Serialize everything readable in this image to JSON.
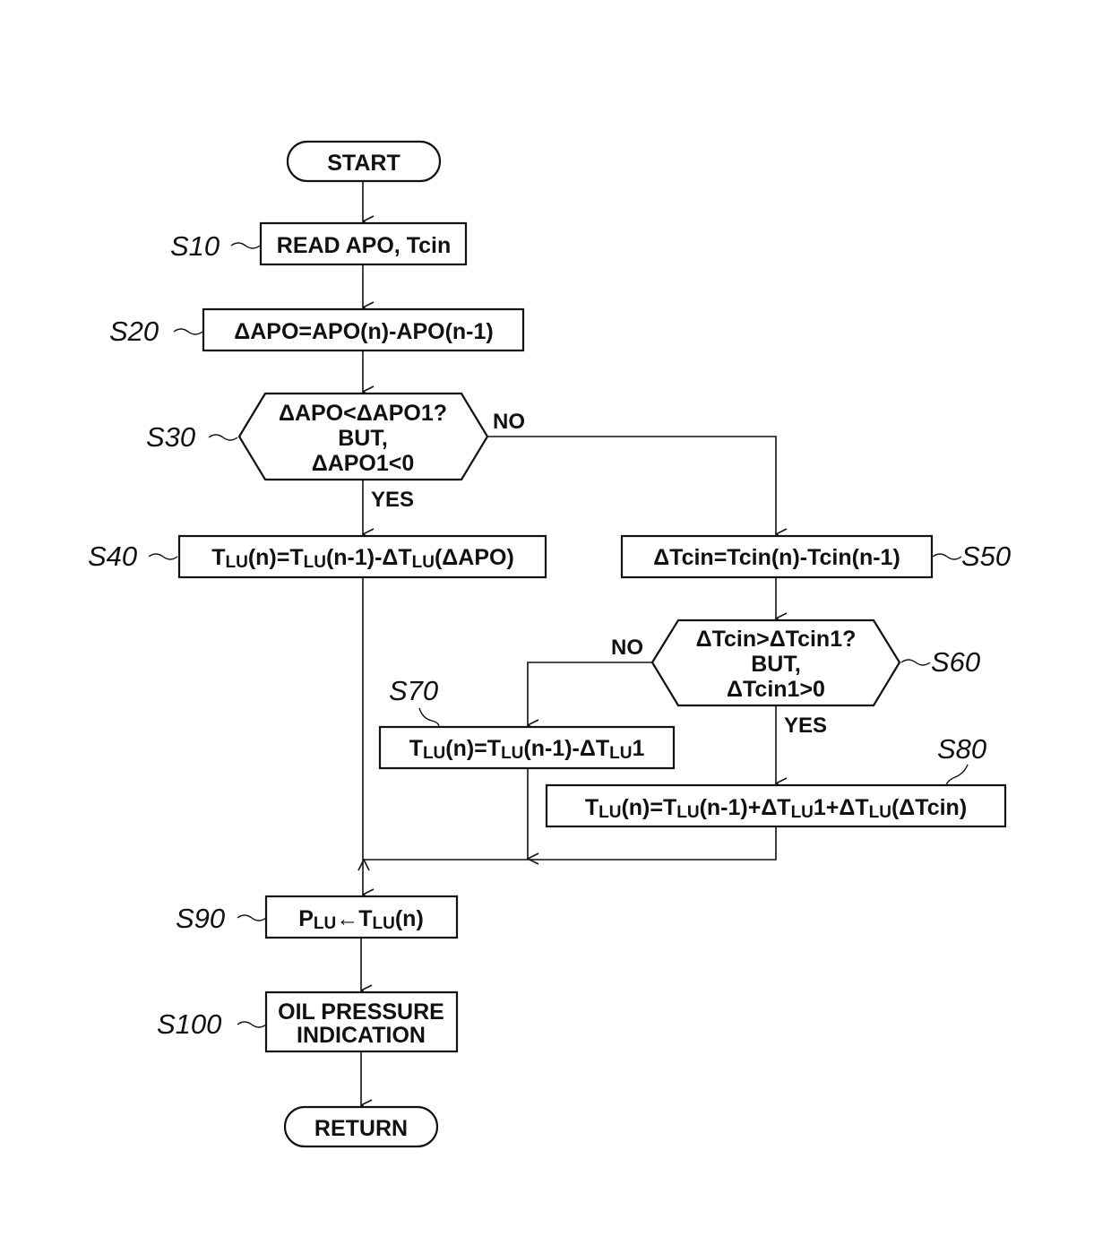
{
  "diagram": {
    "type": "flowchart",
    "terminals": {
      "start": "START",
      "return": "RETURN"
    },
    "steps": {
      "s10": {
        "label": "S10",
        "text": "READ APO, Tcin"
      },
      "s20": {
        "label": "S20",
        "text": "ΔAPO=APO(n)-APO(n-1)"
      },
      "s30": {
        "label": "S30",
        "line1": "ΔAPO<ΔAPO1?",
        "line2": "BUT,",
        "line3": "ΔAPO1<0",
        "yes": "YES",
        "no": "NO"
      },
      "s40": {
        "label": "S40",
        "parts": [
          "T",
          "LU",
          "(n)=T",
          "LU",
          "(n-1)-ΔT",
          "LU",
          "(ΔAPO)"
        ]
      },
      "s50": {
        "label": "S50",
        "text": "ΔTcin=Tcin(n)-Tcin(n-1)"
      },
      "s60": {
        "label": "S60",
        "line1": "ΔTcin>ΔTcin1?",
        "line2": "BUT,",
        "line3": "ΔTcin1>0",
        "yes": "YES",
        "no": "NO"
      },
      "s70": {
        "label": "S70",
        "parts": [
          "T",
          "LU",
          "(n)=T",
          "LU",
          "(n-1)-ΔT",
          "LU",
          "1"
        ]
      },
      "s80": {
        "label": "S80",
        "parts": [
          "T",
          "LU",
          "(n)=T",
          "LU",
          "(n-1)+ΔT",
          "LU",
          "1+ΔT",
          "LU",
          "(ΔTcin)"
        ]
      },
      "s90": {
        "label": "S90",
        "parts": [
          "P",
          "LU",
          "←T",
          "LU",
          "(n)"
        ]
      },
      "s100": {
        "label": "S100",
        "line1": "OIL PRESSURE",
        "line2": "INDICATION"
      }
    }
  }
}
